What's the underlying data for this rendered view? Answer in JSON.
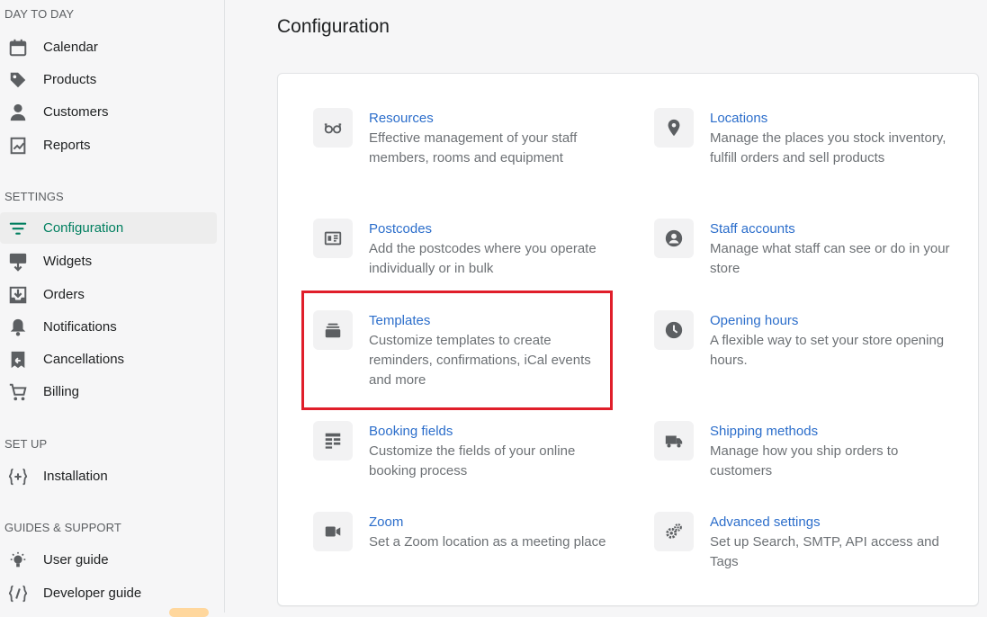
{
  "sidebar": {
    "sections": [
      {
        "title": "DAY TO DAY",
        "items": [
          {
            "label": "Calendar",
            "icon": "calendar-icon"
          },
          {
            "label": "Products",
            "icon": "tag-icon"
          },
          {
            "label": "Customers",
            "icon": "person-icon"
          },
          {
            "label": "Reports",
            "icon": "reports-icon"
          }
        ]
      },
      {
        "title": "SETTINGS",
        "items": [
          {
            "label": "Configuration",
            "icon": "sliders-icon",
            "active": true
          },
          {
            "label": "Widgets",
            "icon": "widgets-icon"
          },
          {
            "label": "Orders",
            "icon": "orders-icon"
          },
          {
            "label": "Notifications",
            "icon": "bell-icon"
          },
          {
            "label": "Cancellations",
            "icon": "cancellations-icon"
          },
          {
            "label": "Billing",
            "icon": "cart-icon"
          }
        ]
      },
      {
        "title": "SET UP",
        "items": [
          {
            "label": "Installation",
            "icon": "code-plus-icon"
          }
        ]
      },
      {
        "title": "GUIDES & SUPPORT",
        "items": [
          {
            "label": "User guide",
            "icon": "lightbulb-icon"
          },
          {
            "label": "Developer guide",
            "icon": "code-slash-icon"
          }
        ]
      }
    ]
  },
  "page": {
    "title": "Configuration"
  },
  "settings": [
    {
      "title": "Resources",
      "description": "Effective management of your staff members, rooms and equipment",
      "icon": "glasses-icon"
    },
    {
      "title": "Locations",
      "description": "Manage the places you stock inventory, fulfill orders and sell products",
      "icon": "location-pin-icon"
    },
    {
      "title": "Postcodes",
      "description": "Add the postcodes where you operate individually or in bulk",
      "icon": "postcode-icon"
    },
    {
      "title": "Staff accounts",
      "description": "Manage what staff can see or do in your store",
      "icon": "user-circle-icon"
    },
    {
      "title": "Templates",
      "description": "Customize templates to create reminders, confirmations, iCal events and more",
      "icon": "templates-icon"
    },
    {
      "title": "Opening hours",
      "description": "A flexible way to set your store opening hours.",
      "icon": "clock-icon"
    },
    {
      "title": "Booking fields",
      "description": "Customize the fields of your online booking process",
      "icon": "fields-icon"
    },
    {
      "title": "Shipping methods",
      "description": "Manage how you ship orders to customers",
      "icon": "truck-icon"
    },
    {
      "title": "Zoom",
      "description": "Set a Zoom location as a meeting place",
      "icon": "video-icon"
    },
    {
      "title": "Advanced settings",
      "description": "Set up Search, SMTP, API access and Tags",
      "icon": "gears-icon"
    }
  ],
  "colors": {
    "accent": "#007f5f",
    "link": "#2c6ecb",
    "highlight": "#e01e2a"
  }
}
